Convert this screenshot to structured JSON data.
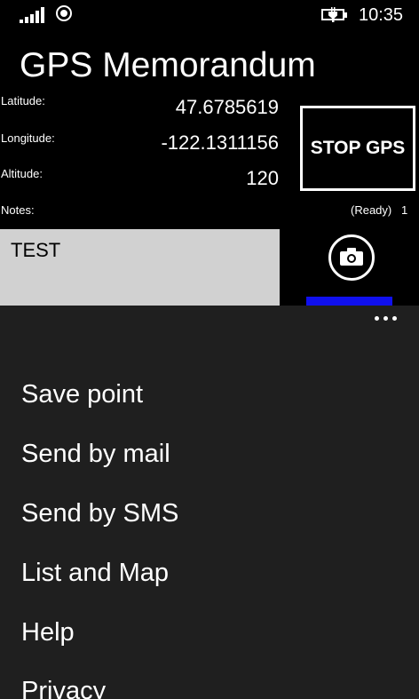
{
  "status_bar": {
    "signal_icon": "signal-strength-icon",
    "location_icon": "location-active-icon",
    "battery_icon": "battery-charging-icon",
    "time": "10:35"
  },
  "app": {
    "title": "GPS Memorandum"
  },
  "fields": {
    "latitude_label": "Latitude:",
    "latitude_value": "47.6785619",
    "longitude_label": "Longitude:",
    "longitude_value": "-122.1311156",
    "altitude_label": "Altitude:",
    "altitude_value": "120",
    "notes_label": "Notes:",
    "notes_value": "TEST"
  },
  "gps": {
    "stop_label": "STOP GPS",
    "status": "(Ready)",
    "count": "1"
  },
  "camera": {
    "icon": "camera-icon"
  },
  "colors": {
    "background": "#000000",
    "menu_background": "#1f1f1f",
    "notes_background": "#d1d1d1",
    "accent_bar": "#1010ee"
  },
  "menu": {
    "more_icon": "ellipsis-icon",
    "items": [
      {
        "label": "Save point"
      },
      {
        "label": "Send by mail"
      },
      {
        "label": "Send by SMS"
      },
      {
        "label": "List and Map"
      },
      {
        "label": "Help"
      },
      {
        "label": "Privacy"
      }
    ]
  }
}
